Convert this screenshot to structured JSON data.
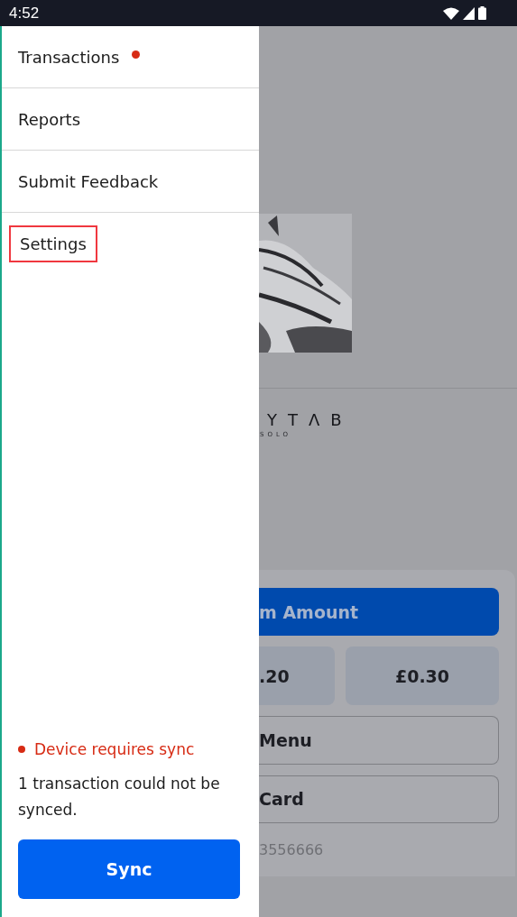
{
  "status_bar": {
    "time": "4:52"
  },
  "drawer": {
    "items": [
      {
        "label": "Transactions",
        "badge": true,
        "highlighted": false
      },
      {
        "label": "Reports",
        "badge": false,
        "highlighted": false
      },
      {
        "label": "Submit Feedback",
        "badge": false,
        "highlighted": false
      },
      {
        "label": "Settings",
        "badge": false,
        "highlighted": true
      }
    ],
    "sync_status": "Device requires sync",
    "sync_message": "1 transaction could not be synced.",
    "sync_button": "Sync"
  },
  "background": {
    "logo": "YTΛB",
    "logo_subtitle": "SOLO",
    "buttons": [
      {
        "label": "m Amount",
        "kind": "primary"
      },
      {
        "label": ".20",
        "kind": "amount"
      },
      {
        "label": "£0.30",
        "kind": "amount"
      },
      {
        "label": "Menu",
        "kind": "outline"
      },
      {
        "label": "Card",
        "kind": "outline"
      }
    ],
    "footer": "3556666"
  }
}
